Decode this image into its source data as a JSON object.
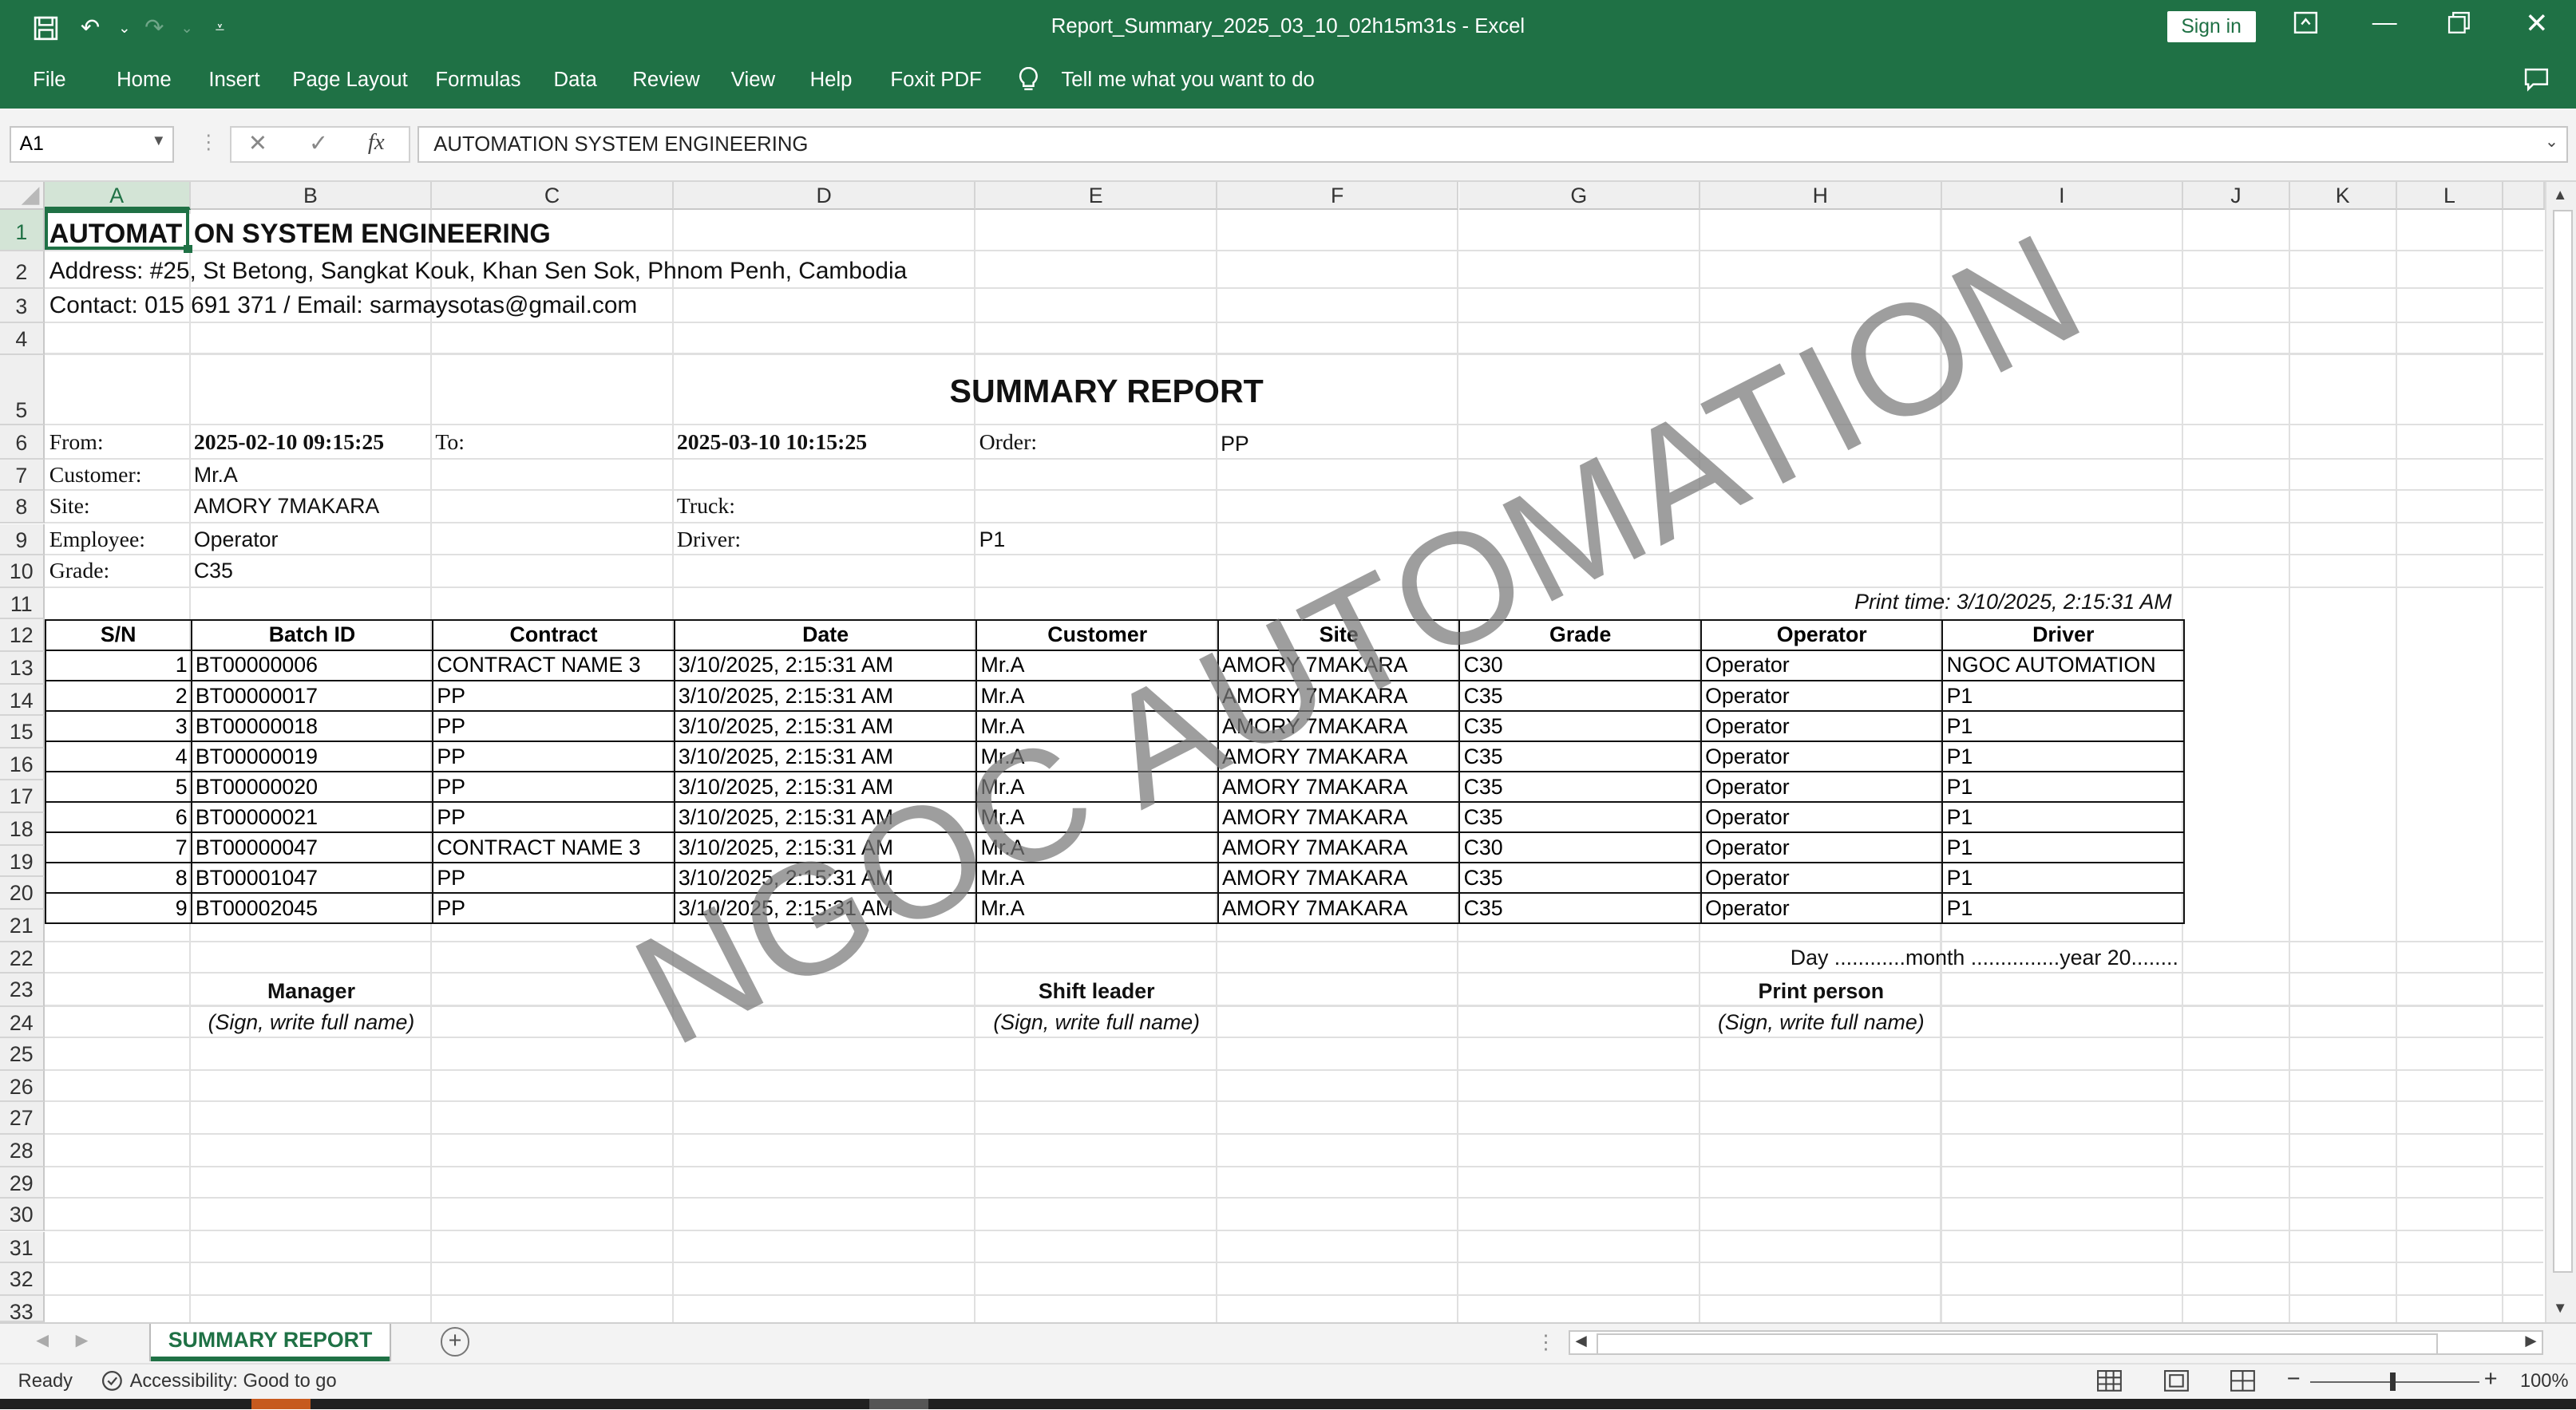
{
  "window": {
    "title": "Report_Summary_2025_03_10_02h15m31s  -  Excel",
    "sign_in": "Sign in"
  },
  "ribbon_tabs": [
    "File",
    "Home",
    "Insert",
    "Page Layout",
    "Formulas",
    "Data",
    "Review",
    "View",
    "Help",
    "Foxit PDF"
  ],
  "tell_me": "Tell me what you want to do",
  "formula_bar": {
    "name_box": "A1",
    "fx": "fx",
    "content": "AUTOMATION SYSTEM ENGINEERING"
  },
  "columns": [
    "A",
    "B",
    "C",
    "D",
    "E",
    "F",
    "G",
    "H",
    "I",
    "J",
    "K",
    "L"
  ],
  "rows": [
    "1",
    "2",
    "3",
    "4",
    "5",
    "6",
    "7",
    "8",
    "9",
    "10",
    "11",
    "12",
    "13",
    "14",
    "15",
    "16",
    "17",
    "18",
    "19",
    "20",
    "21",
    "22",
    "23",
    "24",
    "25",
    "26",
    "27",
    "28",
    "29",
    "30",
    "31",
    "32",
    "33"
  ],
  "header": {
    "company_left": "AUTOMAT",
    "company_right": "ON SYSTEM ENGINEERING",
    "address": "Address: #25, St Betong, Sangkat Kouk, Khan Sen Sok, Phnom Penh, Cambodia",
    "contact": "Contact: 015 691 371 / Email: sarmaysotas@gmail.com",
    "report_title": "SUMMARY REPORT"
  },
  "filters": {
    "from_label": "From:",
    "from_value": "2025-02-10 09:15:25",
    "to_label": "To:",
    "to_value": "2025-03-10 10:15:25",
    "order_label": "Order:",
    "order_value": "PP",
    "customer_label": "Customer:",
    "customer_value": "Mr.A",
    "site_label": "Site:",
    "site_value": "AMORY 7MAKARA",
    "truck_label": "Truck:",
    "employee_label": "Employee:",
    "employee_value": "Operator",
    "driver_label": "Driver:",
    "driver_value": "P1",
    "grade_label": "Grade:",
    "grade_value": "C35"
  },
  "print_time": "Print time: 3/10/2025, 2:15:31 AM",
  "table": {
    "headers": [
      "S/N",
      "Batch ID",
      "Contract",
      "Date",
      "Customer",
      "Site",
      "Grade",
      "Operator",
      "Driver"
    ],
    "rows": [
      [
        "1",
        "BT00000006",
        "CONTRACT NAME 3",
        "3/10/2025, 2:15:31 AM",
        "Mr.A",
        "AMORY 7MAKARA",
        "C30",
        "Operator",
        "NGOC AUTOMATION"
      ],
      [
        "2",
        "BT00000017",
        "PP",
        "3/10/2025, 2:15:31 AM",
        "Mr.A",
        "AMORY 7MAKARA",
        "C35",
        "Operator",
        "P1"
      ],
      [
        "3",
        "BT00000018",
        "PP",
        "3/10/2025, 2:15:31 AM",
        "Mr.A",
        "AMORY 7MAKARA",
        "C35",
        "Operator",
        "P1"
      ],
      [
        "4",
        "BT00000019",
        "PP",
        "3/10/2025, 2:15:31 AM",
        "Mr.A",
        "AMORY 7MAKARA",
        "C35",
        "Operator",
        "P1"
      ],
      [
        "5",
        "BT00000020",
        "PP",
        "3/10/2025, 2:15:31 AM",
        "Mr.A",
        "AMORY 7MAKARA",
        "C35",
        "Operator",
        "P1"
      ],
      [
        "6",
        "BT00000021",
        "PP",
        "3/10/2025, 2:15:31 AM",
        "Mr.A",
        "AMORY 7MAKARA",
        "C35",
        "Operator",
        "P1"
      ],
      [
        "7",
        "BT00000047",
        "CONTRACT NAME 3",
        "3/10/2025, 2:15:31 AM",
        "Mr.A",
        "AMORY 7MAKARA",
        "C30",
        "Operator",
        "P1"
      ],
      [
        "8",
        "BT00001047",
        "PP",
        "3/10/2025, 2:15:31 AM",
        "Mr.A",
        "AMORY 7MAKARA",
        "C35",
        "Operator",
        "P1"
      ],
      [
        "9",
        "BT00002045",
        "PP",
        "3/10/2025, 2:15:31 AM",
        "Mr.A",
        "AMORY 7MAKARA",
        "C35",
        "Operator",
        "P1"
      ]
    ]
  },
  "footer": {
    "date_line": "Day ............month ...............year 20........",
    "manager": "Manager",
    "shift_leader": "Shift leader",
    "print_person": "Print person",
    "sign_note": "(Sign, write full name)"
  },
  "watermark": "NGOC AUTOMATION",
  "sheet_tab": "SUMMARY REPORT",
  "status": {
    "ready": "Ready",
    "accessibility": "Accessibility: Good to go",
    "zoom": "100%"
  },
  "colors": {
    "excel_green": "#1f7145"
  }
}
